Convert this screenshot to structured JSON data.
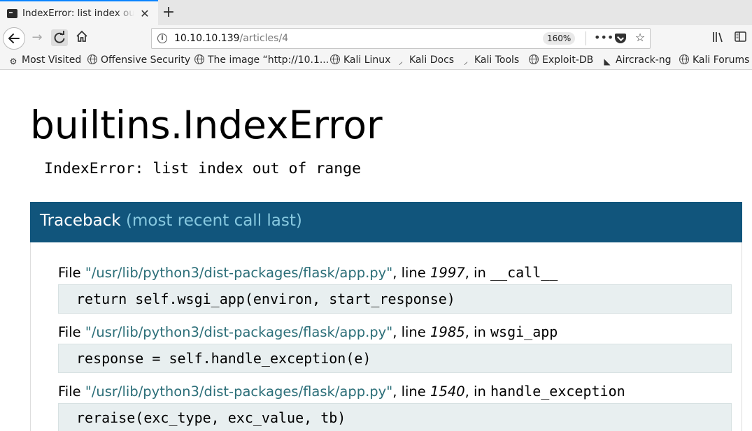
{
  "browser": {
    "tab_title": "IndexError: list index out of range",
    "url_host": "10.10.10.139",
    "url_path": "/articles/4",
    "zoom": "160%",
    "bookmarks": [
      {
        "label": "Most Visited",
        "icon": "gear-icon"
      },
      {
        "label": "Offensive Security",
        "icon": "globe-icon"
      },
      {
        "label": "The image “http://10.1...",
        "icon": "globe-icon"
      },
      {
        "label": "Kali Linux",
        "icon": "globe-icon"
      },
      {
        "label": "Kali Docs",
        "icon": "kali-dragon-icon"
      },
      {
        "label": "Kali Tools",
        "icon": "kali-dragon-icon"
      },
      {
        "label": "Exploit-DB",
        "icon": "globe-icon"
      },
      {
        "label": "Aircrack-ng",
        "icon": "aircrack-icon"
      },
      {
        "label": "Kali Forums",
        "icon": "globe-icon"
      }
    ]
  },
  "error": {
    "title": "builtins.IndexError",
    "message": "IndexError: list index out of range"
  },
  "traceback": {
    "title": "Traceback",
    "subtitle": "(most recent call last)",
    "frames": [
      {
        "file_prefix": "File ",
        "path": "\"/usr/lib/python3/dist-packages/flask/app.py\"",
        "line_prefix": ", line ",
        "line": "1997",
        "in_prefix": ", in ",
        "func": "__call__",
        "code": "return self.wsgi_app(environ, start_response)"
      },
      {
        "file_prefix": "File ",
        "path": "\"/usr/lib/python3/dist-packages/flask/app.py\"",
        "line_prefix": ", line ",
        "line": "1985",
        "in_prefix": ", in ",
        "func": "wsgi_app",
        "code": "response = self.handle_exception(e)"
      },
      {
        "file_prefix": "File ",
        "path": "\"/usr/lib/python3/dist-packages/flask/app.py\"",
        "line_prefix": ", line ",
        "line": "1540",
        "in_prefix": ", in ",
        "func": "handle_exception",
        "code": "reraise(exc_type, exc_value, tb)"
      }
    ]
  },
  "colors": {
    "traceback_header_bg": "#11557c",
    "traceback_subtitle": "#88c9e0",
    "file_path": "#2b6e78",
    "code_bg": "#e8eff0"
  }
}
